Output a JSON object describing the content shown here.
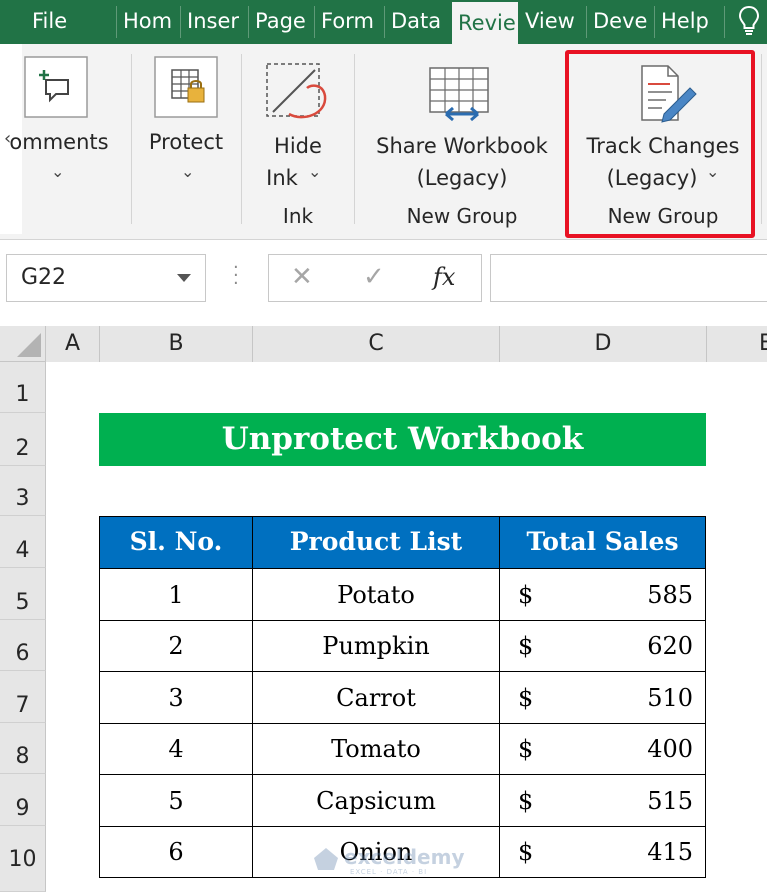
{
  "tabs": [
    {
      "label": "File",
      "active": false
    },
    {
      "label": "Hom",
      "active": false
    },
    {
      "label": "Inser",
      "active": false
    },
    {
      "label": "Page",
      "active": false
    },
    {
      "label": "Form",
      "active": false
    },
    {
      "label": "Data",
      "active": false
    },
    {
      "label": "Revie",
      "active": true
    },
    {
      "label": "View",
      "active": false
    },
    {
      "label": "Deve",
      "active": false
    },
    {
      "label": "Help",
      "active": false
    }
  ],
  "tell_me_icon": "lightbulb-icon",
  "ribbon": {
    "comments": {
      "label": "omments",
      "icon": "new-comment-icon"
    },
    "protect": {
      "label": "Protect",
      "icon": "protect-lock-icon"
    },
    "hide_ink": {
      "label_line1": "Hide",
      "label_line2": "Ink",
      "group": "Ink",
      "icon": "hide-ink-icon"
    },
    "share_workbook": {
      "label_line1": "Share Workbook",
      "label_line2": "(Legacy)",
      "group": "New Group",
      "icon": "share-workbook-icon"
    },
    "track_changes": {
      "label_line1": "Track Changes",
      "label_line2": "(Legacy)",
      "group": "New Group",
      "icon": "track-changes-icon"
    }
  },
  "formula_bar": {
    "name_box": "G22",
    "cancel_symbol": "✕",
    "enter_symbol": "✓",
    "fx_label": "fx",
    "formula": ""
  },
  "columns": [
    "A",
    "B",
    "C",
    "D",
    "E"
  ],
  "rows": [
    "1",
    "2",
    "3",
    "4",
    "5",
    "6",
    "7",
    "8",
    "9",
    "10"
  ],
  "sheet": {
    "title": "Unprotect Workbook",
    "headers": [
      "Sl. No.",
      "Product List",
      "Total Sales"
    ],
    "currency": "$",
    "data": [
      {
        "sl": "1",
        "product": "Potato",
        "sales": "585"
      },
      {
        "sl": "2",
        "product": "Pumpkin",
        "sales": "620"
      },
      {
        "sl": "3",
        "product": "Carrot",
        "sales": "510"
      },
      {
        "sl": "4",
        "product": "Tomato",
        "sales": "400"
      },
      {
        "sl": "5",
        "product": "Capsicum",
        "sales": "515"
      },
      {
        "sl": "6",
        "product": "Onion",
        "sales": "415"
      }
    ]
  },
  "watermark": {
    "text": "exceldemy",
    "sub": "EXCEL · DATA · BI"
  },
  "colors": {
    "excel_green": "#217346",
    "title_fill": "#00b050",
    "header_fill": "#0070c0",
    "highlight": "#e81123"
  }
}
